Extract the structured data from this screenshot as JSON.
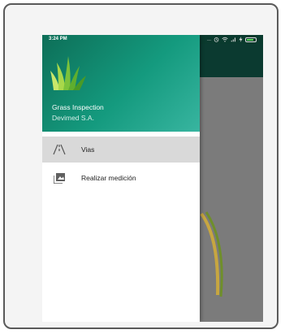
{
  "status_bar": {
    "time": "3:24 PM",
    "icons": [
      "alarm-icon",
      "wifi-icon",
      "signal-icon",
      "charging-icon",
      "battery-icon"
    ],
    "dots": "..."
  },
  "drawer": {
    "app_name": "Grass Inspection",
    "company": "Devimed S.A.",
    "items": [
      {
        "label": "Vias",
        "icon": "road-icon",
        "selected": true
      },
      {
        "label": "Realizar medición",
        "icon": "photo-icon",
        "selected": false
      }
    ]
  },
  "colors": {
    "header_start": "#0d6e57",
    "header_end": "#38b5a0",
    "app_bar": "#0b3a30",
    "selected_item": "#d9d9d9",
    "scrim": "#7b7b7b"
  }
}
